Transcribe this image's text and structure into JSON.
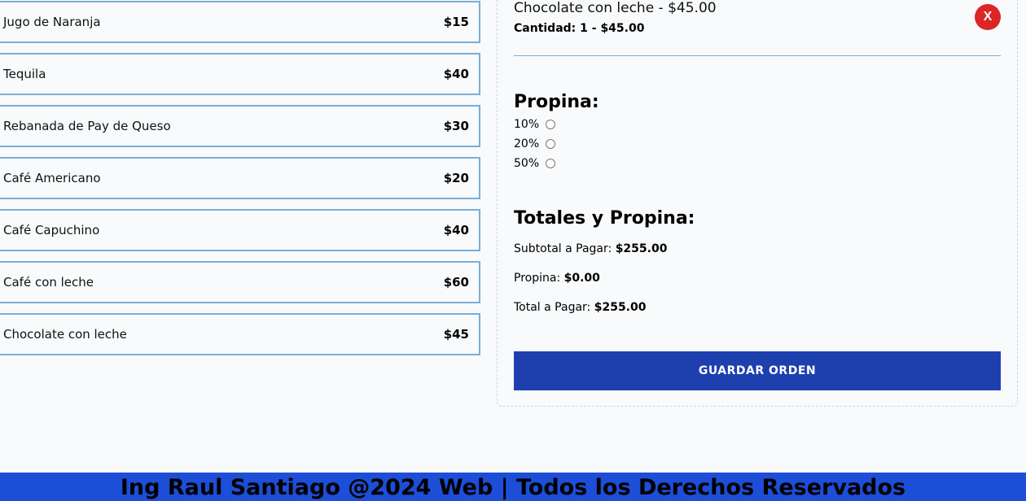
{
  "menu": {
    "items": [
      {
        "name": "Jugo de Naranja",
        "price": "$15"
      },
      {
        "name": "Tequila",
        "price": "$40"
      },
      {
        "name": "Rebanada de Pay de Queso",
        "price": "$30"
      },
      {
        "name": "Café Americano",
        "price": "$20"
      },
      {
        "name": "Café Capuchino",
        "price": "$40"
      },
      {
        "name": "Café con leche",
        "price": "$60"
      },
      {
        "name": "Chocolate con leche",
        "price": "$45"
      }
    ]
  },
  "order": {
    "item": {
      "title": "Chocolate con leche - $45.00",
      "quantity_line": "Cantidad: 1 - $45.00",
      "remove_label": "X"
    },
    "tip": {
      "heading": "Propina:",
      "options": [
        "10%",
        "20%",
        "50%"
      ]
    },
    "totals": {
      "heading": "Totales y Propina:",
      "subtotal_label": "Subtotal a Pagar:",
      "subtotal_value": "$255.00",
      "tip_label": "Propina:",
      "tip_value": "$0.00",
      "total_label": "Total a Pagar:",
      "total_value": "$255.00"
    },
    "save_label": "GUARDAR ORDEN"
  },
  "footer": {
    "text": "Ing Raul Santiago @2024 Web | Todos los Derechos Reservados"
  },
  "colors": {
    "accent": "#1e40af",
    "footer": "#1d4ed8",
    "remove": "#dc2626",
    "border": "#7aaed6"
  }
}
